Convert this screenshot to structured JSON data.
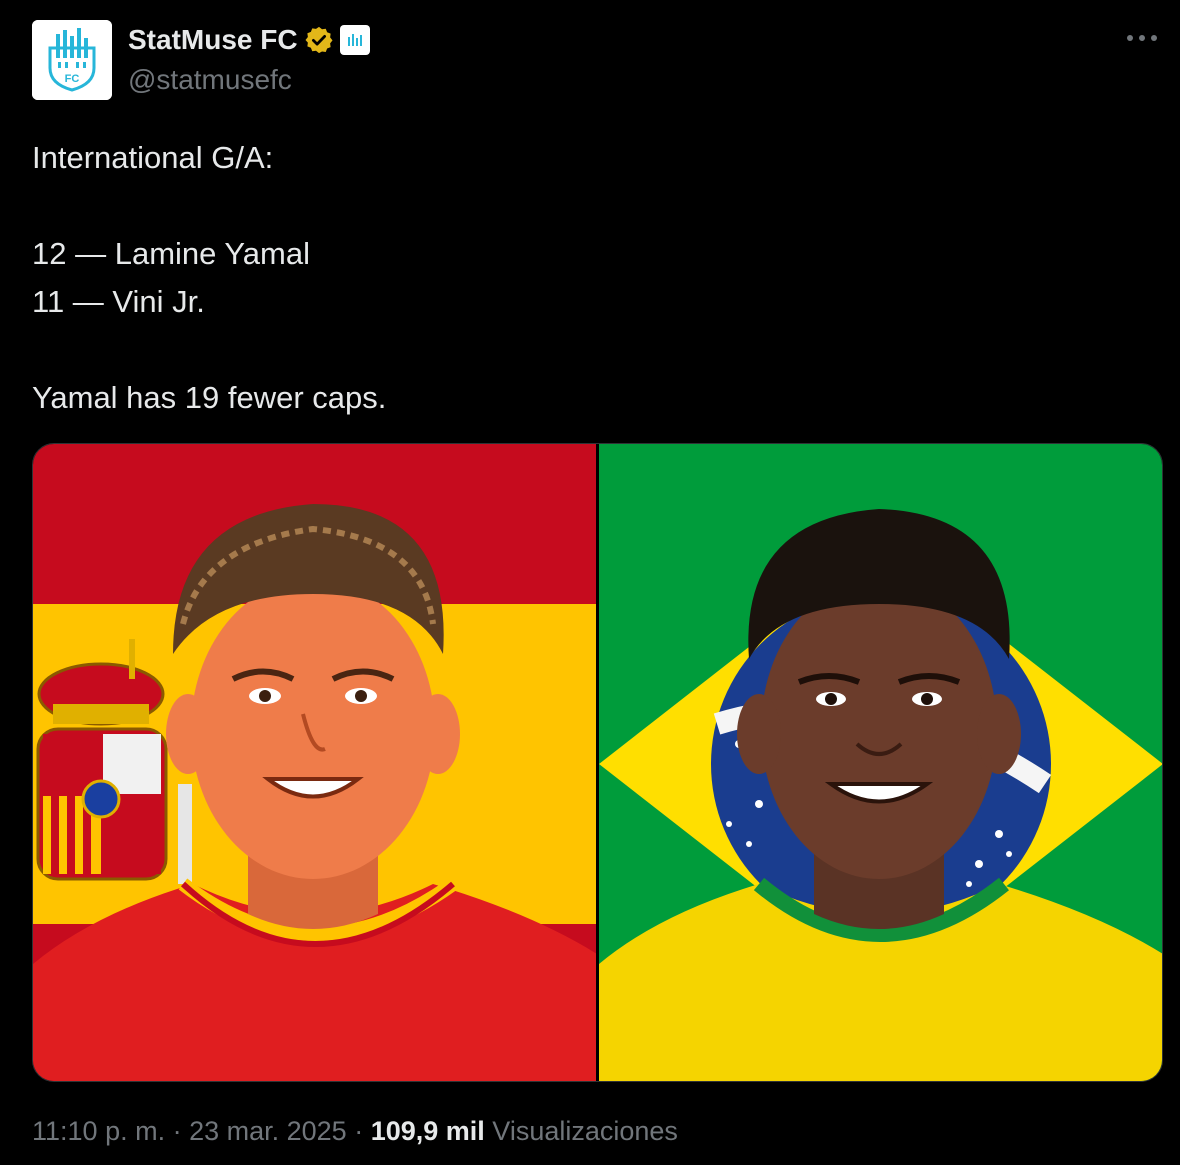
{
  "author": {
    "display_name": "StatMuse FC",
    "handle": "@statmusefc"
  },
  "tweet": {
    "lines": [
      "International G/A:",
      "",
      "12 — Lamine Yamal",
      "11 — Vini Jr.",
      "",
      "Yamal has 19 fewer caps."
    ]
  },
  "media": {
    "left_panel": {
      "flag_colors": [
        "#c60b1e",
        "#ffc400"
      ]
    },
    "right_panel": {
      "flag_colors": [
        "#009c3b",
        "#ffdf00",
        "#002776"
      ]
    }
  },
  "meta": {
    "time": "11:10 p. m.",
    "separator": " · ",
    "date": "23 mar. 2025",
    "views_count": "109,9 mil",
    "views_label": "Visualizaciones"
  },
  "icons": {
    "verified": "verified-badge-icon",
    "affiliate": "affiliate-logo-icon",
    "more": "more-options-icon"
  },
  "colors": {
    "background": "#000000",
    "text": "#e7e9ea",
    "muted": "#71767b",
    "verified_gold": "#e2b719",
    "brand_blue": "#1d9bf0"
  }
}
